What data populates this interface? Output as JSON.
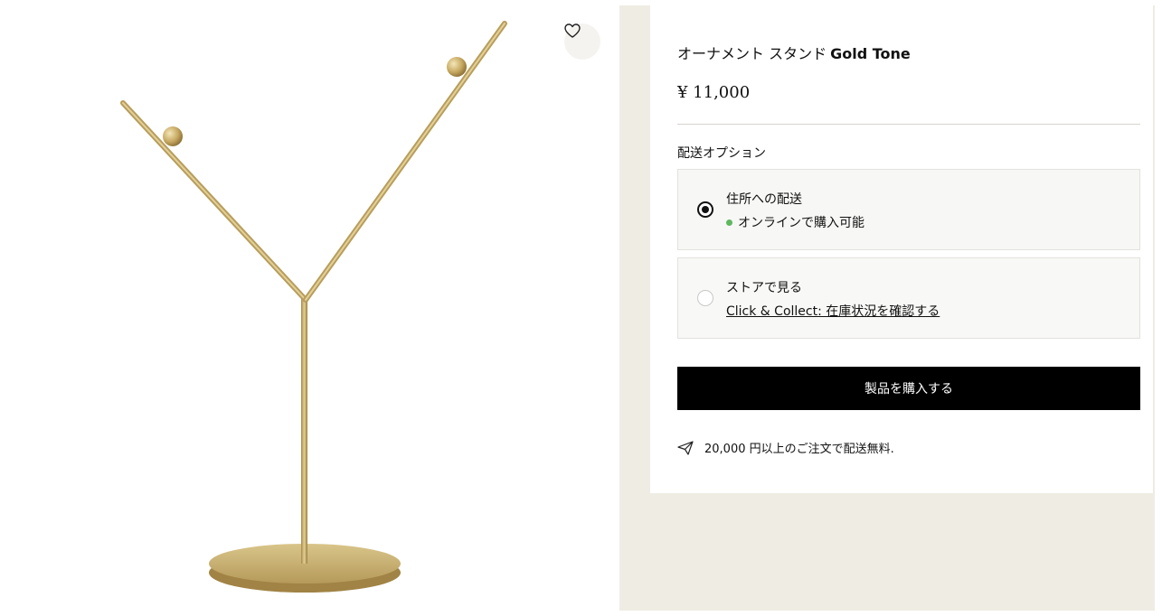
{
  "product": {
    "title_jp": "オーナメント スタンド",
    "title_tone": "Gold Tone",
    "price": "¥ 11,000"
  },
  "delivery": {
    "label": "配送オプション",
    "options": [
      {
        "title": "住所への配送",
        "status": "オンラインで購入可能",
        "selected": true
      },
      {
        "title": "ストアで見る",
        "link": "Click & Collect: 在庫状況を確認する",
        "selected": false
      }
    ]
  },
  "buy_button": "製品を購入する",
  "shipping_note": "20,000 円以上のご注文で配送無料.",
  "icons": {
    "favorite": "heart-icon",
    "shipping": "paper-plane-icon"
  },
  "colors": {
    "buy_button_bg": "#000000",
    "availability_dot": "#5fb760",
    "side_panel_bg": "#efece4"
  }
}
